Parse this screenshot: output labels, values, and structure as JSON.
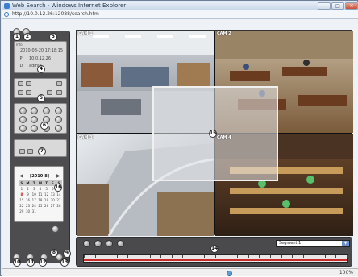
{
  "window": {
    "title": "Web Search - Windows Internet Explorer",
    "url": "http://10.0.12.26:12088/search.htm"
  },
  "panel": {
    "info_label": "Info",
    "datetime": "2010-08-20 17:18:15",
    "ip_prefix": "IP",
    "ip": "10.0.12.26",
    "user_prefix": "ID",
    "user": "admin",
    "calendar_title": "[2010-8]",
    "weekdays": [
      "S",
      "M",
      "T",
      "W",
      "T",
      "F",
      "S"
    ],
    "days": [
      1,
      2,
      3,
      4,
      5,
      6,
      7,
      8,
      9,
      10,
      11,
      12,
      13,
      14,
      15,
      16,
      17,
      18,
      19,
      20,
      21,
      22,
      23,
      24,
      25,
      26,
      27,
      28,
      29,
      30,
      31
    ],
    "highlighted_days": [
      7,
      8
    ]
  },
  "cameras": [
    {
      "label": "CAM 1"
    },
    {
      "label": "CAM 2"
    },
    {
      "label": "CAM 3"
    },
    {
      "label": "CAM 4"
    }
  ],
  "toolbar": {
    "segment_value": "Segment 1",
    "segment_arrow": "▼"
  },
  "status": {
    "zoom": "100%"
  },
  "markers": [
    "1",
    "2",
    "3",
    "4",
    "5",
    "6",
    "7",
    "8",
    "9",
    "10",
    "11",
    "12",
    "13",
    "14",
    "15",
    "16"
  ],
  "icons": {
    "app": "ie-icon",
    "globe": "internet-zone-icon"
  },
  "colors": {
    "panel_bg": "#4d4d4f",
    "timeline_track": "#c92b2b",
    "segment_arrow": "#6d8fc7"
  }
}
